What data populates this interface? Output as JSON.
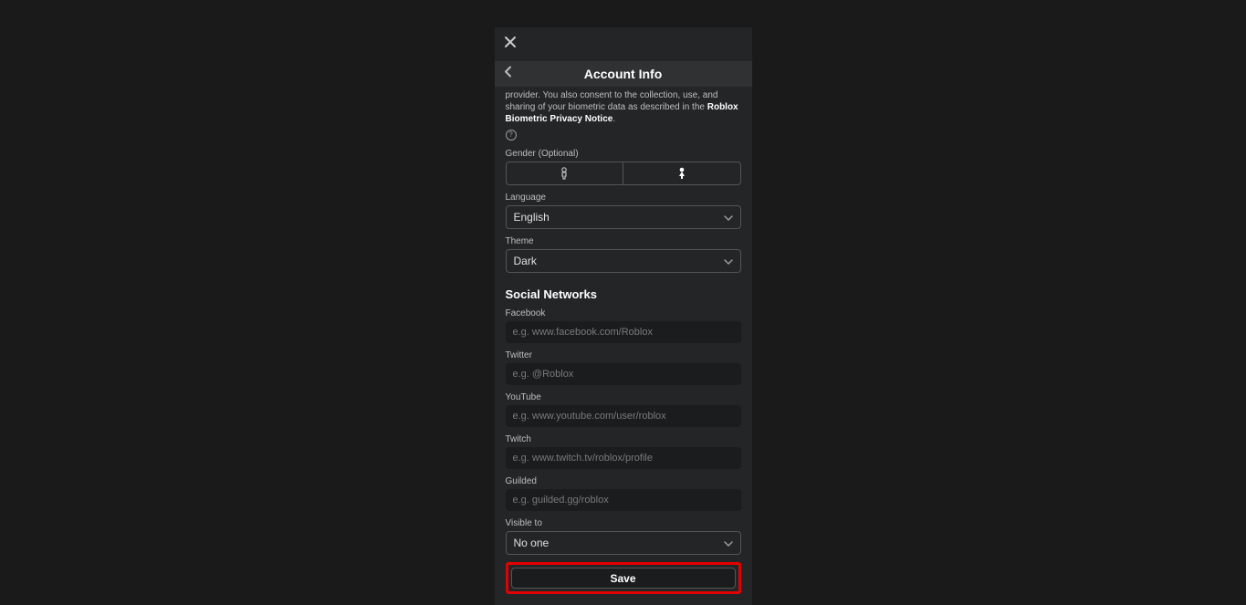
{
  "header": {
    "title": "Account Info"
  },
  "consent": {
    "text_part": "provider. You also consent to the collection, use, and sharing of your biometric data as described in the ",
    "link_text": "Roblox Biometric Privacy Notice",
    "period": "."
  },
  "gender": {
    "label": "Gender (Optional)"
  },
  "language": {
    "label": "Language",
    "value": "English"
  },
  "theme": {
    "label": "Theme",
    "value": "Dark"
  },
  "social": {
    "title": "Social Networks",
    "facebook": {
      "label": "Facebook",
      "placeholder": "e.g. www.facebook.com/Roblox"
    },
    "twitter": {
      "label": "Twitter",
      "placeholder": "e.g. @Roblox"
    },
    "youtube": {
      "label": "YouTube",
      "placeholder": "e.g. www.youtube.com/user/roblox"
    },
    "twitch": {
      "label": "Twitch",
      "placeholder": "e.g. www.twitch.tv/roblox/profile"
    },
    "guilded": {
      "label": "Guilded",
      "placeholder": "e.g. guilded.gg/roblox"
    }
  },
  "visible_to": {
    "label": "Visible to",
    "value": "No one"
  },
  "save": {
    "label": "Save"
  }
}
